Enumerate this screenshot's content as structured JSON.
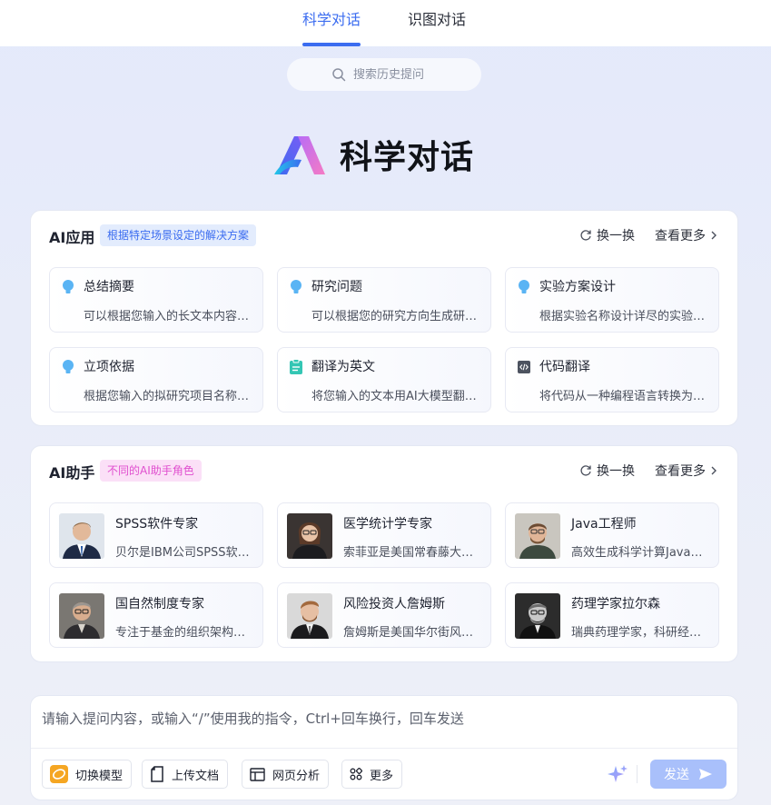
{
  "tabs": [
    {
      "label": "科学对话",
      "active": true
    },
    {
      "label": "识图对话",
      "active": false
    }
  ],
  "search": {
    "placeholder": "搜索历史提问"
  },
  "brand": {
    "title": "科学对话"
  },
  "apps": {
    "title": "AI应用",
    "tag": "根据特定场景设定的解决方案",
    "refresh": "换一换",
    "more": "查看更多",
    "items": [
      {
        "title": "总结摘要",
        "desc": "可以根据您输入的长文本内容生成摘要",
        "icon": "bulb-icon"
      },
      {
        "title": "研究问题",
        "desc": "可以根据您的研究方向生成研究问题",
        "icon": "bulb-icon"
      },
      {
        "title": "实验方案设计",
        "desc": "根据实验名称设计详尽的实验方案",
        "icon": "bulb-icon"
      },
      {
        "title": "立项依据",
        "desc": "根据您输入的拟研究项目名称生成立项依据",
        "icon": "bulb-icon"
      },
      {
        "title": "翻译为英文",
        "desc": "将您输入的文本用AI大模型翻译为英文",
        "icon": "clipboard-icon"
      },
      {
        "title": "代码翻译",
        "desc": "将代码从一种编程语言转换为另一种",
        "icon": "code-icon"
      }
    ]
  },
  "assistants": {
    "title": "AI助手",
    "tag": "不同的AI助手角色",
    "refresh": "换一换",
    "more": "查看更多",
    "items": [
      {
        "title": "SPSS软件专家",
        "desc": "贝尔是IBM公司SPSS软件专家"
      },
      {
        "title": "医学统计学专家",
        "desc": "索菲亚是美国常春藤大学统计学教授"
      },
      {
        "title": "Java工程师",
        "desc": "高效生成科学计算Java代码"
      },
      {
        "title": "国自然制度专家",
        "desc": "专注于基金的组织架构与制度"
      },
      {
        "title": "风险投资人詹姆斯",
        "desc": "詹姆斯是美国华尔街风险投资人"
      },
      {
        "title": "药理学家拉尔森",
        "desc": "瑞典药理学家，科研经验丰富"
      }
    ]
  },
  "composer": {
    "placeholder": "请输入提问内容，或输入“/”使用我的指令，Ctrl+回车换行，回车发送",
    "tools": [
      {
        "label": "切换模型",
        "icon": "model-icon"
      },
      {
        "label": "上传文档",
        "icon": "document-icon"
      },
      {
        "label": "网页分析",
        "icon": "webpage-icon"
      },
      {
        "label": "更多",
        "icon": "grid-icon"
      }
    ],
    "send": "发送"
  },
  "colors": {
    "accent": "#3b6cf0",
    "send_button": "#a9c0fb",
    "apps_tag_bg": "#e3ecfd",
    "assistants_tag_bg": "#fbe0f7"
  }
}
